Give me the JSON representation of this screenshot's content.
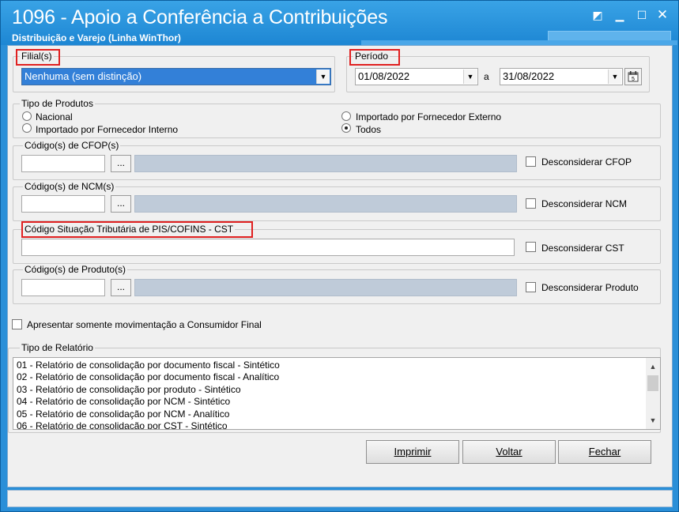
{
  "window": {
    "title": "1096 - Apoio a Conferência a Contribuições",
    "subtitle": "Distribuição e Varejo (Linha WinThor)",
    "controls": {
      "help": "◩",
      "minimize": "▁",
      "maximize": "☐",
      "close": "✕"
    }
  },
  "filial": {
    "legend": "Filial(s)",
    "selected": "Nenhuma (sem distinção)"
  },
  "periodo": {
    "legend": "Período",
    "start": "01/08/2022",
    "separator": "a",
    "end": "31/08/2022"
  },
  "tipo_produtos": {
    "legend": "Tipo de Produtos",
    "options": [
      {
        "label": "Nacional",
        "selected": false
      },
      {
        "label": "Importado por Fornecedor Interno",
        "selected": false
      },
      {
        "label": "Importado por Fornecedor Externo",
        "selected": false
      },
      {
        "label": "Todos",
        "selected": true
      }
    ]
  },
  "cfop": {
    "legend": "Código(s) de CFOP(s)",
    "browse": "...",
    "ignore_label": "Desconsiderar CFOP"
  },
  "ncm": {
    "legend": "Código(s) de NCM(s)",
    "browse": "...",
    "ignore_label": "Desconsiderar NCM"
  },
  "cst": {
    "legend": "Código Situação Tributária de PIS/COFINS - CST",
    "ignore_label": "Desconsiderar CST"
  },
  "produto": {
    "legend": "Código(s) de Produto(s)",
    "browse": "...",
    "ignore_label": "Desconsiderar Produto"
  },
  "consumidor_final": {
    "label": "Apresentar somente movimentação a Consumidor Final"
  },
  "tipo_relatorio": {
    "legend": "Tipo de Relatório",
    "items": [
      "01 - Relatório de consolidação por documento fiscal - Sintético",
      "02 - Relatório de consolidação por documento fiscal - Analítico",
      "03 - Relatório de consolidação por produto - Sintético",
      "04 - Relatório de consolidação por NCM - Sintético",
      "05 - Relatório de consolidação por NCM - Analítico",
      "06 - Relatório de consolidação por CST - Sintético"
    ]
  },
  "buttons": {
    "print": "Imprimir",
    "back": "Voltar",
    "close": "Fechar"
  },
  "colors": {
    "titlebar": "#1d86d3",
    "selection": "#3380d8",
    "highlight_box": "#e02020"
  }
}
